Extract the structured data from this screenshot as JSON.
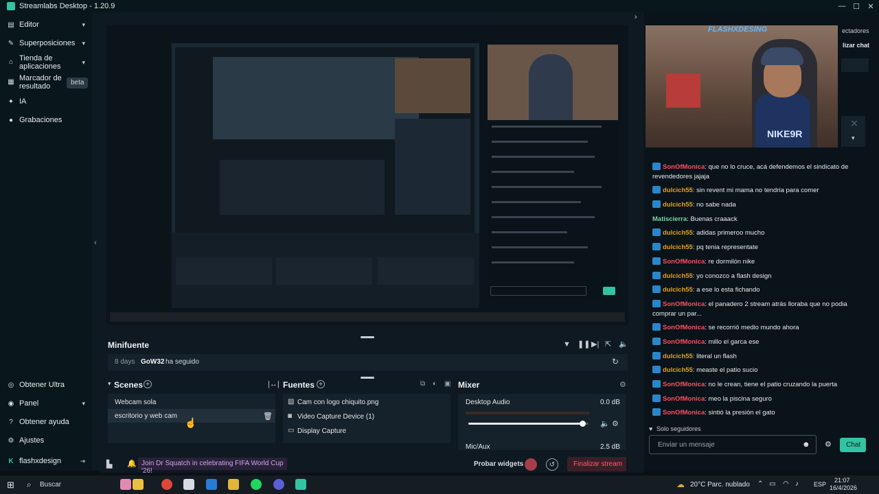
{
  "app": {
    "title": "Streamlabs Desktop - 1.20.9"
  },
  "sidebar": {
    "items": [
      {
        "label": "Editor",
        "icon": "editor-icon",
        "chevron": true
      },
      {
        "label": "Superposiciones",
        "icon": "overlays-icon",
        "chevron": true
      },
      {
        "label": "Tienda de aplicaciones",
        "icon": "store-icon",
        "chevron": true
      },
      {
        "label": "Marcador de resultado",
        "icon": "scoreboard-icon",
        "badge": "beta"
      },
      {
        "label": "IA",
        "icon": "ai-icon"
      },
      {
        "label": "Grabaciones",
        "icon": "recordings-icon"
      }
    ],
    "bottom": [
      {
        "label": "Obtener Ultra",
        "icon": "ultra-icon"
      },
      {
        "label": "Panel",
        "icon": "panel-icon",
        "chevron": true
      },
      {
        "label": "Obtener ayuda",
        "icon": "help-icon"
      },
      {
        "label": "Ajustes",
        "icon": "settings-icon"
      }
    ],
    "user": {
      "name": "flashxdesign"
    }
  },
  "minifuente": {
    "title": "Minifuente",
    "event": {
      "age": "8 days",
      "user": "GoW32",
      "action": "ha seguido"
    }
  },
  "scenes": {
    "title": "Scenes",
    "items": [
      {
        "label": "Webcam sola"
      },
      {
        "label": "escritorio y web cam"
      }
    ]
  },
  "fuentes": {
    "title": "Fuentes",
    "items": [
      {
        "label": "Cam con logo chiquito.png",
        "icon": "image-icon"
      },
      {
        "label": "Video Capture Device (1)",
        "icon": "camera-icon"
      },
      {
        "label": "Display Capture",
        "icon": "monitor-icon"
      }
    ]
  },
  "mixer": {
    "title": "Mixer",
    "channels": [
      {
        "label": "Desktop Audio",
        "value": "0.0 dB"
      }
    ],
    "volume_level": 0.95,
    "partial_label": "Mic/Aux",
    "partial_value": "2.5 dB"
  },
  "footer": {
    "banner": "Join Dr Squatch in celebrating FIFA World Cup '26!",
    "test_widgets": "Probar widgets",
    "end_stream": "Finalizar stream"
  },
  "camera": {
    "overlay_name": "FLASHXDESING",
    "shirt_text": "NIKE9R"
  },
  "right_header": {
    "partial1": "ectadores",
    "partial2": "lizar chat"
  },
  "chat": {
    "messages": [
      {
        "user": "SonOfMonica",
        "color": "#ff4d5e",
        "text": ": que no lo cruce, acá defendemos el sindicato de",
        "cont": "revendedores jajaja"
      },
      {
        "user": "dulcich55",
        "color": "#e3a21a",
        "text": ": sin revent mi mama no tendria para comer"
      },
      {
        "user": "dulcich55",
        "color": "#e3a21a",
        "text": ": no sabe nada"
      },
      {
        "user": "Matiscierra",
        "color": "#7ad6a4",
        "text": ": Buenas craaack",
        "nobadge": true
      },
      {
        "user": "dulcich55",
        "color": "#e3a21a",
        "text": ": adidas primeroo mucho"
      },
      {
        "user": "dulcich55",
        "color": "#e3a21a",
        "text": ": pq tenia representate"
      },
      {
        "user": "SonOfMonica",
        "color": "#ff4d5e",
        "text": ": re dormilón nike"
      },
      {
        "user": "dulcich55",
        "color": "#e3a21a",
        "text": ": yo conozco a flash design"
      },
      {
        "user": "dulcich55",
        "color": "#e3a21a",
        "text": ": a ese lo esta fichando"
      },
      {
        "user": "SonOfMonica",
        "color": "#ff4d5e",
        "text": ": el panadero 2 stream atrás lloraba que no podia",
        "cont": "comprar un par..."
      },
      {
        "user": "SonOfMonica",
        "color": "#ff4d5e",
        "text": ": se recorrió medio mundo ahora"
      },
      {
        "user": "SonOfMonica",
        "color": "#ff4d5e",
        "text": ": millo el garca ese"
      },
      {
        "user": "dulcich55",
        "color": "#e3a21a",
        "text": ": literal un flash"
      },
      {
        "user": "dulcich55",
        "color": "#e3a21a",
        "text": ": measte el patio sucio"
      },
      {
        "user": "SonOfMonica",
        "color": "#ff4d5e",
        "text": ": no le crean, tiene el patio cruzando la puerta"
      },
      {
        "user": "SonOfMonica",
        "color": "#ff4d5e",
        "text": ": meo la piscina seguro"
      },
      {
        "user": "SonOfMonica",
        "color": "#ff4d5e",
        "text": ": sintió la presión el gato"
      }
    ],
    "followers_only": "Solo seguidores",
    "input_placeholder": "Enviar un mensaje",
    "send": "Chat"
  },
  "taskbar": {
    "search": "Buscar",
    "weather": "20°C  Parc. nublado",
    "lang": "ESP",
    "time": "21:07",
    "date": "16/4/2026"
  },
  "colors": {
    "accent": "#31c3a2",
    "danger": "#ff5b6b",
    "chat_btn": "#31c3a2"
  }
}
